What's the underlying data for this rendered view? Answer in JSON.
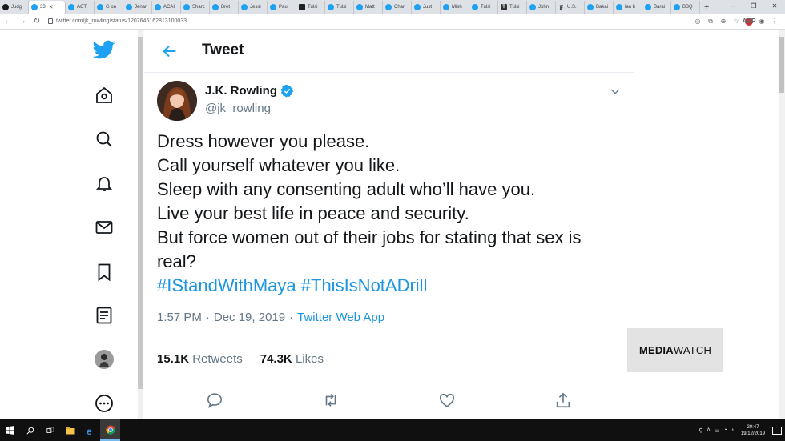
{
  "browser": {
    "tabs": [
      {
        "label": "Judg",
        "icon": "circle"
      },
      {
        "label": "33",
        "icon": "twitter",
        "active": true
      },
      {
        "label": "ACT",
        "icon": "twitter"
      },
      {
        "label": "G on",
        "icon": "twitter"
      },
      {
        "label": "Jenar",
        "icon": "twitter"
      },
      {
        "label": "ACAI",
        "icon": "twitter"
      },
      {
        "label": "Sharc",
        "icon": "twitter"
      },
      {
        "label": "Bret",
        "icon": "twitter"
      },
      {
        "label": "Jessi",
        "icon": "twitter"
      },
      {
        "label": "Paul",
        "icon": "twitter"
      },
      {
        "label": "Tulsi",
        "icon": "square"
      },
      {
        "label": "Tulsi",
        "icon": "twitter"
      },
      {
        "label": "Matt",
        "icon": "twitter"
      },
      {
        "label": "Charl",
        "icon": "twitter"
      },
      {
        "label": "Just",
        "icon": "twitter"
      },
      {
        "label": "Mish",
        "icon": "twitter"
      },
      {
        "label": "Tulsi",
        "icon": "twitter"
      },
      {
        "label": "Tulsi",
        "icon": "t"
      },
      {
        "label": "John",
        "icon": "twitter"
      },
      {
        "label": "U.S.",
        "icon": "f"
      },
      {
        "label": "Bakai",
        "icon": "twitter"
      },
      {
        "label": "ian b",
        "icon": "twitter"
      },
      {
        "label": "Barai",
        "icon": "twitter"
      },
      {
        "label": "BBQ",
        "icon": "twitter"
      }
    ],
    "new_tab": "+",
    "window_controls": {
      "minimize": "–",
      "restore": "❐",
      "close": "✕"
    },
    "url": "twitter.com/jk_rowling/status/1207646162813100033"
  },
  "tweet_page": {
    "header_title": "Tweet",
    "author": {
      "name": "J.K. Rowling",
      "handle": "@jk_rowling"
    },
    "text_lines": [
      "Dress however you please.",
      "Call yourself whatever you like.",
      "Sleep with any consenting adult who’ll have you.",
      "Live your best life in peace and security.",
      "But force women out of their jobs for stating that sex is",
      "real?"
    ],
    "hashtags": [
      "#IStandWithMaya",
      "#ThisIsNotADrill"
    ],
    "meta": {
      "time": "1:57 PM",
      "separator": "·",
      "date": "Dec 19, 2019",
      "client": "Twitter Web App"
    },
    "stats": {
      "retweets_count": "15.1K",
      "retweets_label": "Retweets",
      "likes_count": "74.3K",
      "likes_label": "Likes"
    }
  },
  "watermark": {
    "bold": "MEDIA",
    "light": "WATCH"
  },
  "taskbar": {
    "time": "20:47",
    "date": "19/12/2019"
  },
  "colors": {
    "twitter_blue": "#1da1f2",
    "link_blue": "#1b95e0",
    "text": "#14171a",
    "secondary": "#657786"
  }
}
